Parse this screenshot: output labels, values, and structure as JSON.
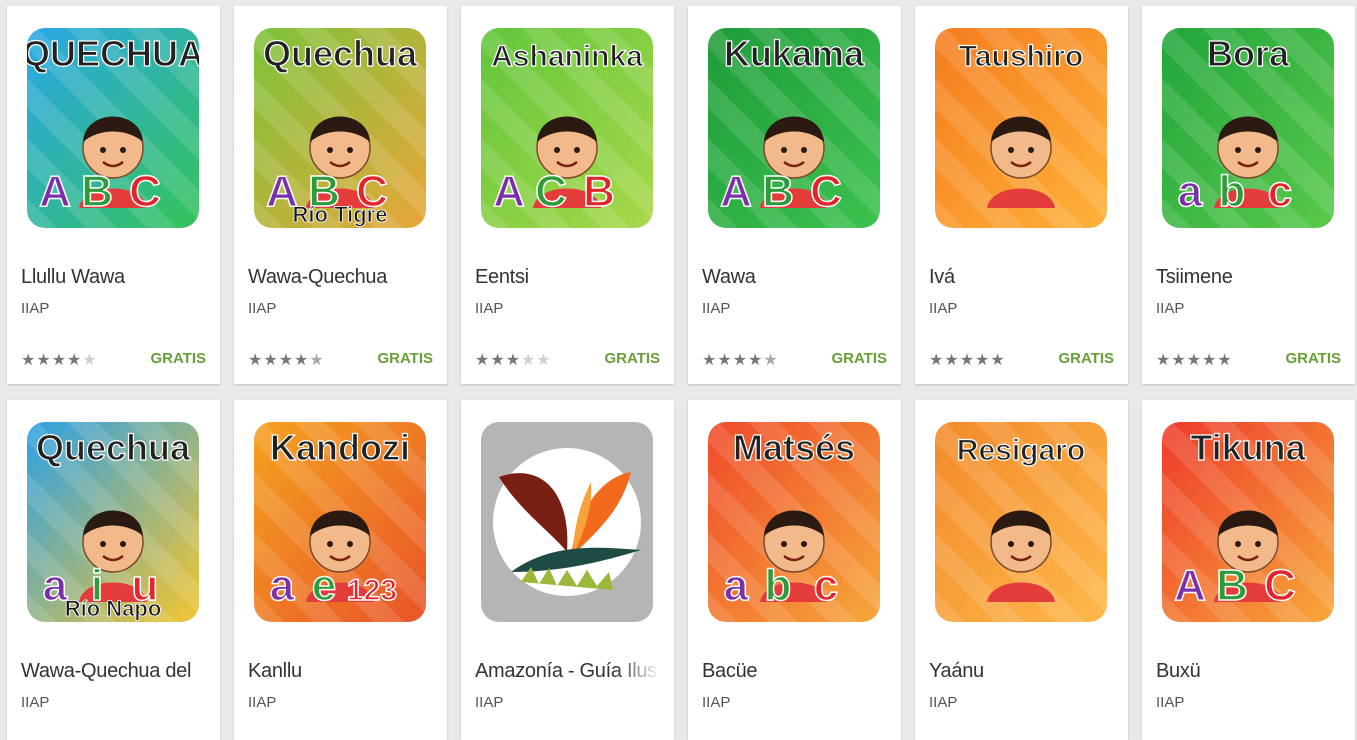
{
  "apps": [
    {
      "title": "Llullu Wawa",
      "developer": "IIAP",
      "rating": 4,
      "price": "GRATIS",
      "icon_name": "quechua-abc-app-icon",
      "icon_text": "QUECHUA",
      "icon_sub": "",
      "letters": [
        "A",
        "B",
        "C"
      ],
      "bg": "#2aa7e8",
      "bg2": "#35c35a"
    },
    {
      "title": "Wawa-Quechua",
      "developer": "IIAP",
      "rating": 4.5,
      "price": "GRATIS",
      "icon_name": "quechua-rio-tigre-app-icon",
      "icon_text": "Quechua",
      "icon_sub": "Río Tigre",
      "letters": [
        "A",
        "B",
        "C"
      ],
      "bg": "#7cc33a",
      "bg2": "#e9a63a"
    },
    {
      "title": "Eentsi",
      "developer": "IIAP",
      "rating": 3,
      "price": "GRATIS",
      "icon_name": "ashaninka-app-icon",
      "icon_text": "Ashaninka",
      "icon_sub": "",
      "letters": [
        "A",
        "C",
        "B"
      ],
      "bg": "#62c63c",
      "bg2": "#a8d84a"
    },
    {
      "title": "Wawa",
      "developer": "IIAP",
      "rating": 4.5,
      "price": "GRATIS",
      "icon_name": "kukama-app-icon",
      "icon_text": "Kukama",
      "icon_sub": "",
      "letters": [
        "A",
        "B",
        "C"
      ],
      "bg": "#1f9c3a",
      "bg2": "#3cc24e"
    },
    {
      "title": "Ivá",
      "developer": "IIAP",
      "rating": 5,
      "price": "GRATIS",
      "icon_name": "taushiro-app-icon",
      "icon_text": "Taushiro",
      "icon_sub": "",
      "letters": [],
      "bg": "#f47c1e",
      "bg2": "#ffb23a"
    },
    {
      "title": "Tsiimene",
      "developer": "IIAP",
      "rating": 5,
      "price": "GRATIS",
      "icon_name": "bora-app-icon",
      "icon_text": "Bora",
      "icon_sub": "",
      "letters": [
        "a",
        "b",
        "c"
      ],
      "bg": "#21a53b",
      "bg2": "#59c94b"
    },
    {
      "title": "Wawa-Quechua del",
      "developer": "IIAP",
      "rating": null,
      "price": "",
      "icon_name": "quechua-rio-napo-app-icon",
      "icon_text": "Quechua",
      "icon_sub": "Río Napo",
      "letters": [
        "a",
        "i",
        "u"
      ],
      "bg": "#2ca0e6",
      "bg2": "#f5c531"
    },
    {
      "title": "Kanllu",
      "developer": "IIAP",
      "rating": null,
      "price": "",
      "icon_name": "kandozi-app-icon",
      "icon_text": "Kandozi",
      "icon_sub": "",
      "letters": [
        "a",
        "e",
        "123"
      ],
      "bg": "#f4a21e",
      "bg2": "#e9542a"
    },
    {
      "title": "Amazonía - Guía Ilus",
      "developer": "IIAP",
      "rating": null,
      "price": "",
      "icon_name": "amazonia-guide-logo-icon",
      "icon_text": "",
      "icon_sub": "",
      "letters": [],
      "bg": "#b5b5b5",
      "bg2": "#ffffff"
    },
    {
      "title": "Bacüe",
      "developer": "IIAP",
      "rating": null,
      "price": "",
      "icon_name": "matses-app-icon",
      "icon_text": "Matsés",
      "icon_sub": "",
      "letters": [
        "a",
        "b",
        "c"
      ],
      "bg": "#ef4a2a",
      "bg2": "#f6a83a"
    },
    {
      "title": "Yaánu",
      "developer": "IIAP",
      "rating": null,
      "price": "",
      "icon_name": "resigaro-app-icon",
      "icon_text": "Resigaro",
      "icon_sub": "",
      "letters": [],
      "bg": "#f28a2a",
      "bg2": "#ffb84a"
    },
    {
      "title": "Buxü",
      "developer": "IIAP",
      "rating": null,
      "price": "",
      "icon_name": "tikuna-app-icon",
      "icon_text": "Tikuna",
      "icon_sub": "",
      "letters": [
        "A",
        "B",
        "C"
      ],
      "bg": "#ee3b2b",
      "bg2": "#f7a83a"
    }
  ]
}
